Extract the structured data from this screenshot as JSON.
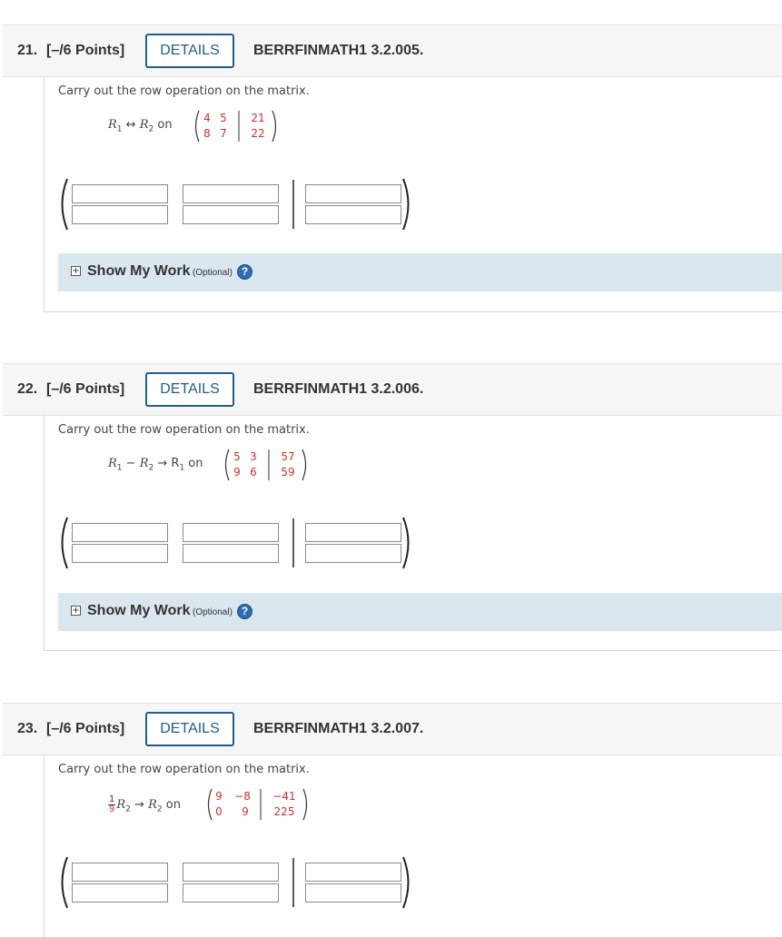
{
  "questions": [
    {
      "number": "21.",
      "points": "[–/6 Points]",
      "details_label": "DETAILS",
      "code": "BERRFINMATH1 3.2.005.",
      "prompt": "Carry out the row operation on the matrix.",
      "operation": {
        "lhs_a": "R",
        "sub_a": "1",
        "symbol": " ↔ ",
        "rhs": "R",
        "sub_b": "2",
        "tail": "",
        "tail_sub": "",
        "on": " on"
      },
      "matrix": {
        "row1": [
          "4",
          "5"
        ],
        "rhs1": "21",
        "row2": [
          "8",
          "7"
        ],
        "rhs2": "22"
      },
      "show_my_work": {
        "label": "Show My Work",
        "optional": "(Optional)",
        "plus": "+",
        "help": "?"
      }
    },
    {
      "number": "22.",
      "points": "[–/6 Points]",
      "details_label": "DETAILS",
      "code": "BERRFINMATH1 3.2.006.",
      "prompt": "Carry out the row operation on the matrix.",
      "operation": {
        "lhs_a": "R",
        "sub_a": "1",
        "symbol": " − ",
        "rhs": "R",
        "sub_b": "2",
        "tail": " → R",
        "tail_sub": "1",
        "on": " on"
      },
      "matrix": {
        "row1": [
          "5",
          "3"
        ],
        "rhs1": "57",
        "row2": [
          "9",
          "6"
        ],
        "rhs2": "59"
      },
      "show_my_work": {
        "label": "Show My Work",
        "optional": "(Optional)",
        "plus": "+",
        "help": "?"
      }
    },
    {
      "number": "23.",
      "points": "[–/6 Points]",
      "details_label": "DETAILS",
      "code": "BERRFINMATH1 3.2.007.",
      "prompt": "Carry out the row operation on the matrix.",
      "operation": {
        "frac_num": "1",
        "frac_den": "9",
        "lhs_a": "R",
        "sub_a": "2",
        "symbol": " → ",
        "rhs": "R",
        "sub_b": "2",
        "on": " on"
      },
      "matrix": {
        "row1": [
          "9",
          "−8"
        ],
        "rhs1": "−41",
        "row2": [
          "0",
          "9"
        ],
        "rhs2": "225"
      }
    }
  ]
}
